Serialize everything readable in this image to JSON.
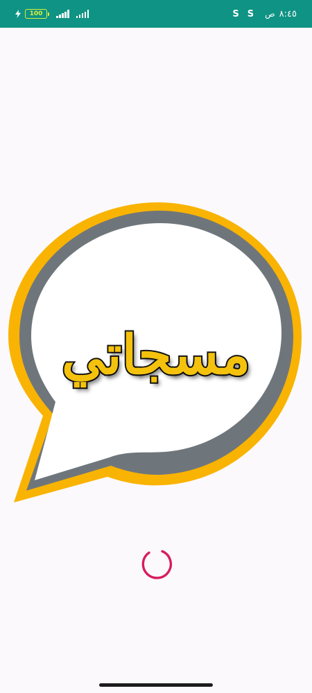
{
  "status_bar": {
    "battery": "100",
    "time": "٨:٤٥",
    "ampm": "ص",
    "s_badge_1": "S",
    "s_badge_2": "S",
    "background_color": "#0f9384"
  },
  "splash": {
    "logo_text": "مسجاتي",
    "colors": {
      "outer_ring": "#f9b302",
      "inner_ring": "#6f767b",
      "bubble": "#ffffff",
      "text_fill": "#f4c20d",
      "text_stroke": "#141414"
    }
  },
  "loader": {
    "color": "#d81b60",
    "icon": "loading-spinner-icon"
  }
}
